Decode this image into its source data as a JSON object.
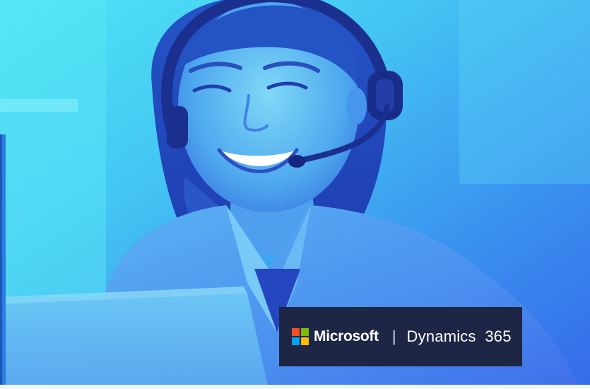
{
  "brand": {
    "company": "Microsoft",
    "separator": "|",
    "product": "Dynamics",
    "version": "365",
    "logo_colors": [
      "#f25022",
      "#7fba00",
      "#00a4ef",
      "#ffb900"
    ]
  }
}
